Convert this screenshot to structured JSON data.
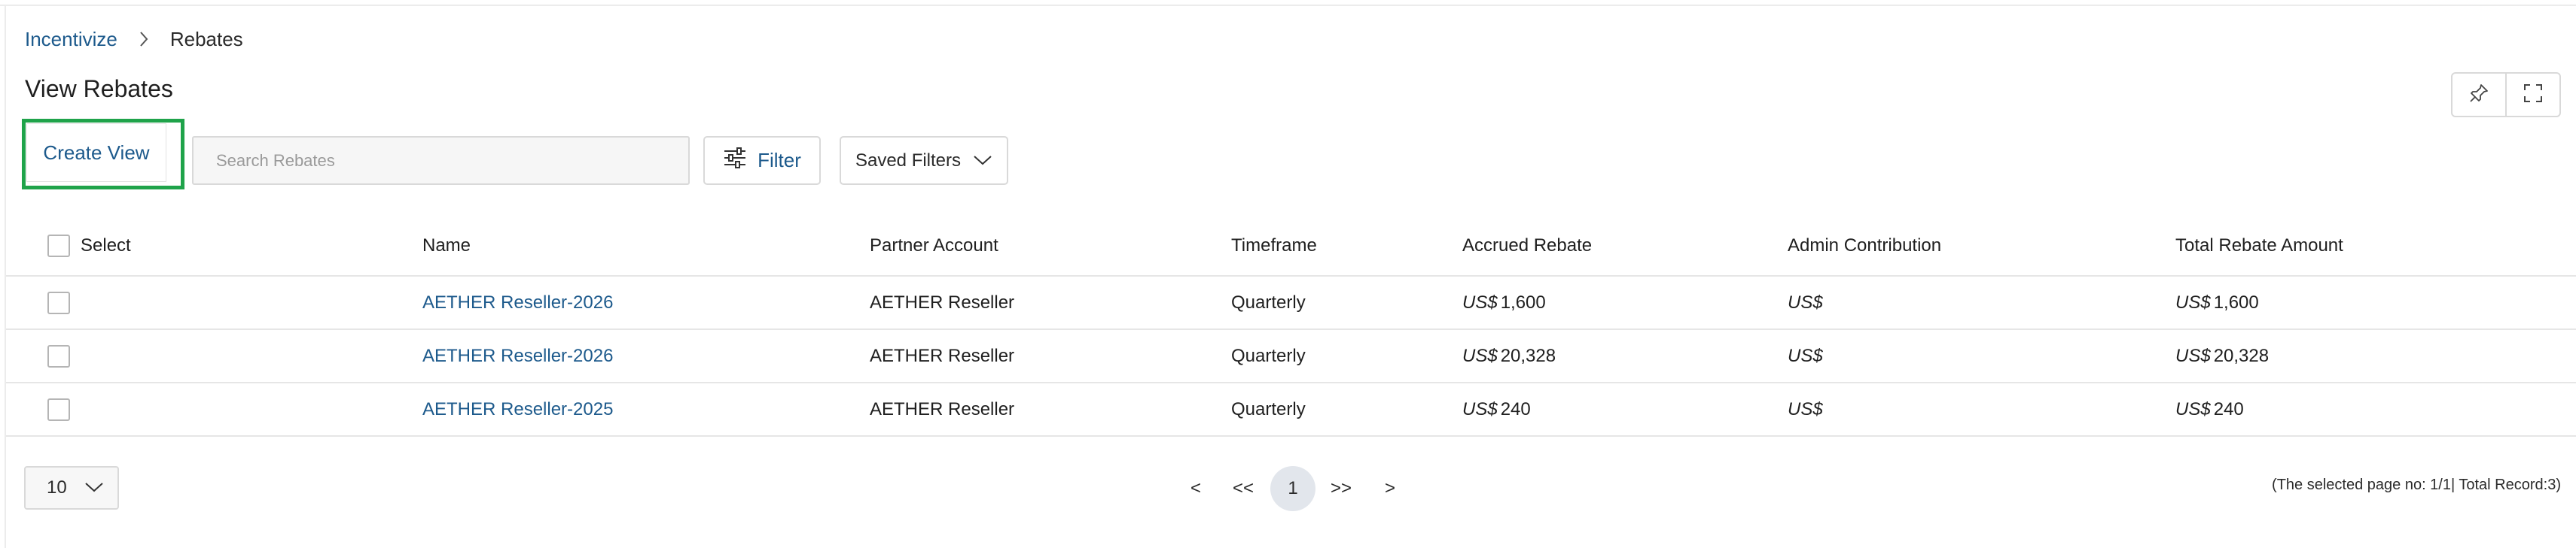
{
  "breadcrumb": {
    "parent": "Incentivize",
    "current": "Rebates"
  },
  "page": {
    "title": "View Rebates"
  },
  "toolbar": {
    "create_view_label": "Create View",
    "search_placeholder": "Search Rebates",
    "filter_label": "Filter",
    "saved_filters_label": "Saved Filters"
  },
  "table": {
    "columns": {
      "select": "Select",
      "name": "Name",
      "partner_account": "Partner Account",
      "timeframe": "Timeframe",
      "accrued_rebate": "Accrued Rebate",
      "admin_contribution": "Admin Contribution",
      "total_rebate_amount": "Total Rebate Amount"
    },
    "rows": [
      {
        "name": "AETHER Reseller-2026",
        "partner_account": "AETHER Reseller",
        "timeframe": "Quarterly",
        "accrued_currency": "US$",
        "accrued_amount": "1,600",
        "admin_currency": "US$",
        "total_currency": "US$",
        "total_amount": "1,600"
      },
      {
        "name": "AETHER Reseller-2026",
        "partner_account": "AETHER Reseller",
        "timeframe": "Quarterly",
        "accrued_currency": "US$",
        "accrued_amount": "20,328",
        "admin_currency": "US$",
        "total_currency": "US$",
        "total_amount": "20,328"
      },
      {
        "name": "AETHER Reseller-2025",
        "partner_account": "AETHER Reseller",
        "timeframe": "Quarterly",
        "accrued_currency": "US$",
        "accrued_amount": "240",
        "admin_currency": "US$",
        "total_currency": "US$",
        "total_amount": "240"
      }
    ]
  },
  "pagination": {
    "page_size": "10",
    "prev": "<",
    "first": "<<",
    "current_page": "1",
    "last": ">>",
    "next": ">",
    "status": "(The selected page no: 1/1| Total Record:3)"
  },
  "colors": {
    "link": "#1d5a8c",
    "highlight": "#1fa34a"
  },
  "icons": {
    "breadcrumb_separator": "chevron-right-icon",
    "pin": "pin-icon",
    "fullscreen": "fullscreen-icon",
    "filter": "sliders-icon",
    "saved_filters": "chevron-down-icon",
    "page_size": "chevron-down-icon"
  }
}
